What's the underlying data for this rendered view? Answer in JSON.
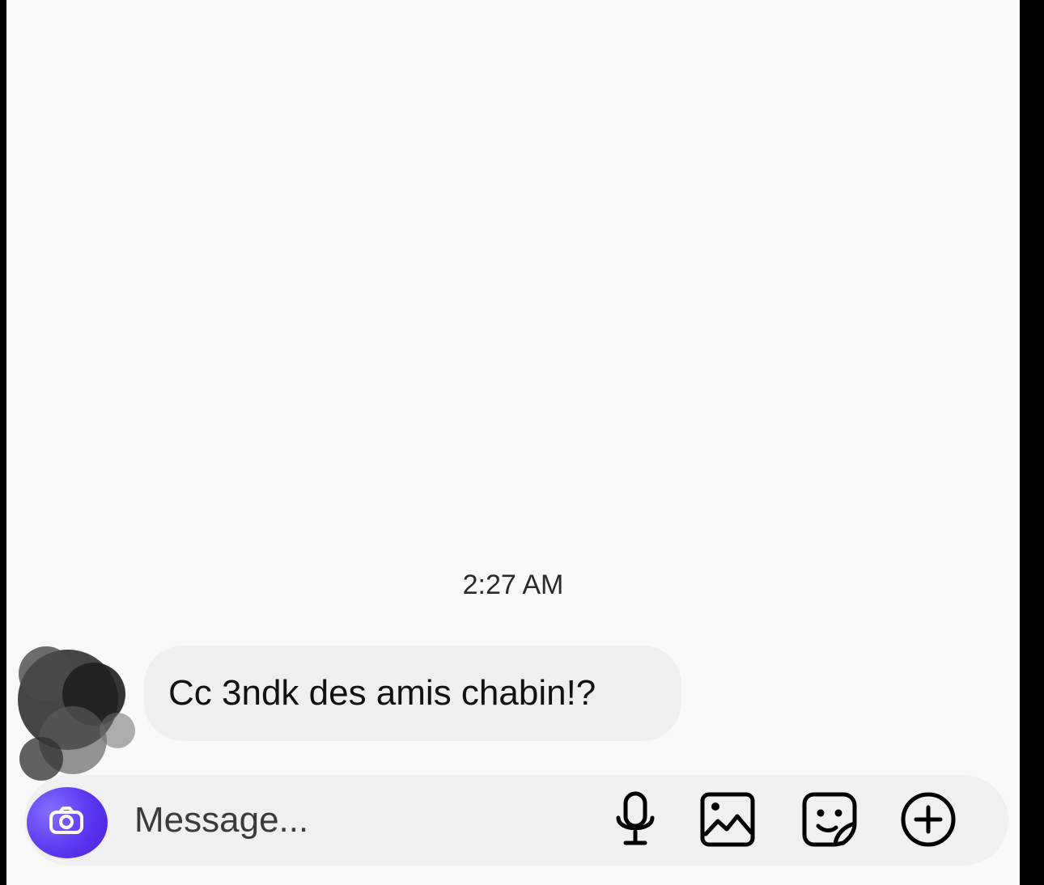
{
  "chat": {
    "timestamp": "2:27 AM",
    "messages": [
      {
        "text": "Cc 3ndk des amis chabin!?"
      }
    ]
  },
  "composer": {
    "placeholder": "Message...",
    "accent_color": "#5b36f0",
    "icons": [
      "camera-icon",
      "microphone-icon",
      "gallery-icon",
      "sticker-icon",
      "plus-icon"
    ]
  }
}
